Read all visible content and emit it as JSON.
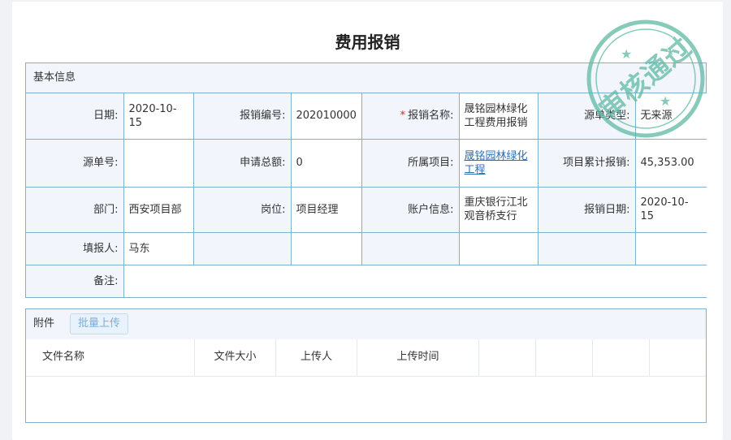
{
  "page": {
    "title": "费用报销"
  },
  "basic_info": {
    "section_title": "基本信息",
    "labels": {
      "date": "日期:",
      "reimb_no": "报销编号:",
      "reimb_name": "报销名称:",
      "source_type": "源单类型:",
      "source_no": "源单号:",
      "total": "申请总额:",
      "project": "所属项目:",
      "project_cumulative": "项目累计报销:",
      "department": "部门:",
      "position": "岗位:",
      "account": "账户信息:",
      "reimb_date": "报销日期:",
      "filler": "填报人:",
      "remark": "备注:"
    },
    "values": {
      "date": "2020-10-15",
      "reimb_no": "202010000",
      "reimb_name": "晟铭园林绿化工程费用报销",
      "source_type": "无来源",
      "source_no": "",
      "total": "0",
      "project": "晟铭园林绿化工程",
      "project_cumulative": "45,353.00",
      "department": "西安项目部",
      "position": "项目经理",
      "account": "重庆银行江北观音桥支行",
      "reimb_date": "2020-10-15",
      "filler": "马东",
      "remark": ""
    },
    "required_mark": "*"
  },
  "attachments": {
    "section_title": "附件",
    "upload_button": "批量上传",
    "columns": [
      "文件名称",
      "文件大小",
      "上传人",
      "上传时间"
    ]
  },
  "stamp": {
    "text": "审核通过",
    "color": "#5fb9a4"
  },
  "colors": {
    "border": "#7fb0cc",
    "header_bg": "#f2f6fc",
    "link": "#2b6fb6",
    "required": "#e02020"
  }
}
